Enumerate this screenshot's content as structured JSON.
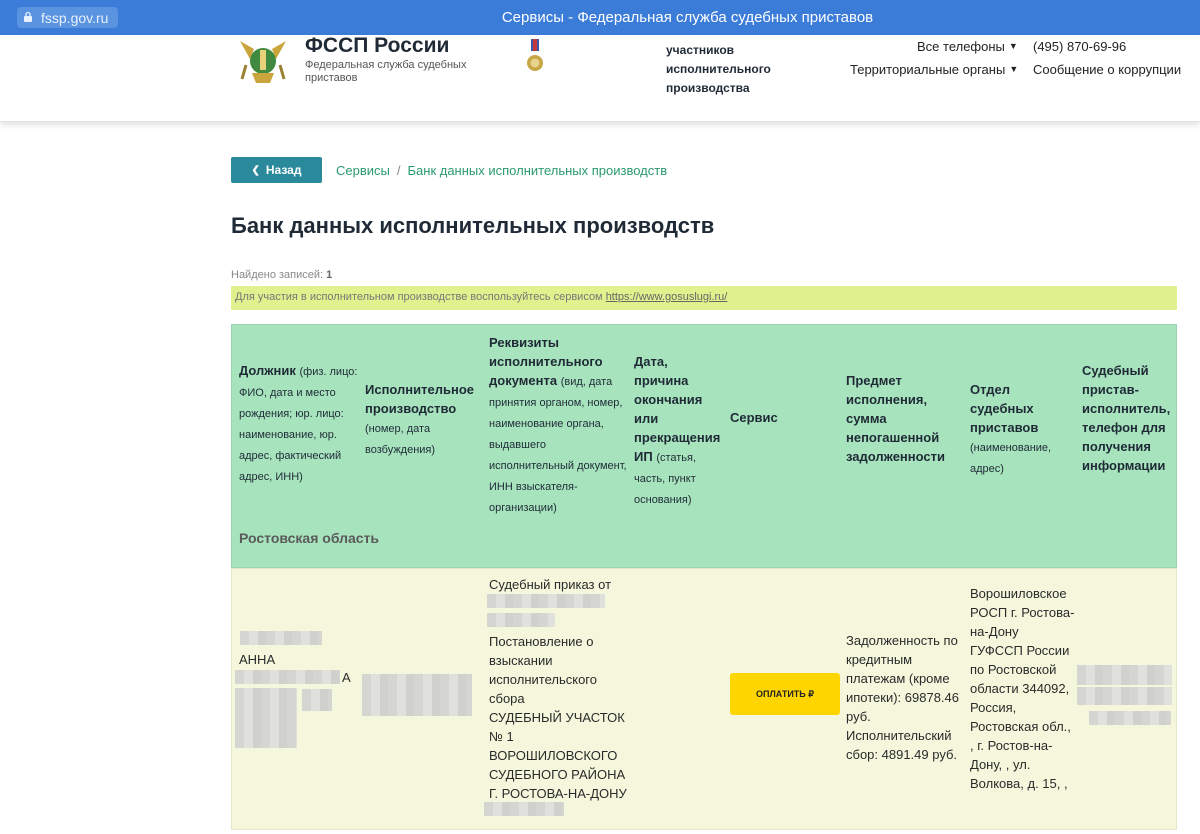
{
  "browser": {
    "url": "fssp.gov.ru",
    "window_title": "Сервисы - Федеральная служба судебных приставов"
  },
  "header": {
    "brand_name": "ФССП России",
    "brand_sub": "Федеральная служба судебных приставов",
    "topic_lines": [
      "участников",
      "исполнительного",
      "производства"
    ],
    "phones_label": "Все телефоны",
    "territorial_label": "Территориальные органы",
    "phone_number": "(495) 870-69-96",
    "corruption_label": "Сообщение о коррупции"
  },
  "nav": {
    "back_label": "Назад",
    "breadcrumb": [
      "Сервисы",
      "Банк данных исполнительных производств"
    ]
  },
  "page": {
    "title": "Банк данных исполнительных производств",
    "records_label": "Найдено записей:",
    "records_count": "1",
    "notice_text": "Для участия в исполнительном производстве воспользуйтесь сервисом",
    "notice_link": "https://www.gosuslugi.ru/"
  },
  "table": {
    "columns": [
      {
        "title": "Должник",
        "sub": "(физ. лицо: ФИО, дата и место рождения; юр. лицо: наименование, юр. адрес, фактический адрес, ИНН)"
      },
      {
        "title": "Исполнительное производство",
        "sub": "(номер, дата возбуждения)"
      },
      {
        "title": "Реквизиты исполнительного документа",
        "sub": "(вид, дата принятия органом, номер, наименование органа, выдавшего исполнительный документ, ИНН взыскателя-организации)"
      },
      {
        "title": "Дата, причина окончания или прекращения ИП",
        "sub": "(статья, часть, пункт основания)"
      },
      {
        "title": "Сервис",
        "sub": ""
      },
      {
        "title": "Предмет исполнения, сумма непогашенной задолженности",
        "sub": ""
      },
      {
        "title": "Отдел судебных приставов",
        "sub": "(наименование, адрес)"
      },
      {
        "title": "Судебный пристав-исполнитель, телефон для получения информации",
        "sub": ""
      }
    ],
    "region": "Ростовская область",
    "row": {
      "debtor_name_visible": "АННА",
      "debtor_suffix": "А",
      "doc_line1": "Судебный приказ от",
      "doc_body": "Постановление о взыскании исполнительского сбора",
      "doc_court": "СУДЕБНЫЙ УЧАСТОК № 1 ВОРОШИЛОВСКОГО СУДЕБНОГО РАЙОНА Г. РОСТОВА-НА-ДОНУ",
      "pay_label": "ОПЛАТИТЬ ₽",
      "subject": "Задолженность по кредитным платежам (кроме ипотеки): 69878.46 руб. Исполнительский сбор: 4891.49 руб.",
      "department": "Ворошиловское РОСП г. Ростова-на-Дону ГУФССП России по Ростовской области 344092, Россия, Ростовская обл., , г. Ростов-на-Дону, , ул. Волкова, д. 15, ,"
    }
  },
  "colors": {
    "browser_bar": "#3b7cd8",
    "header_green": "#a7e4be",
    "row_bg": "#f5f7dd",
    "notice_bg": "#e1f18e",
    "back_button": "#2a8a9c",
    "pay_button": "#ffd500",
    "link_green": "#2a9a6f"
  }
}
